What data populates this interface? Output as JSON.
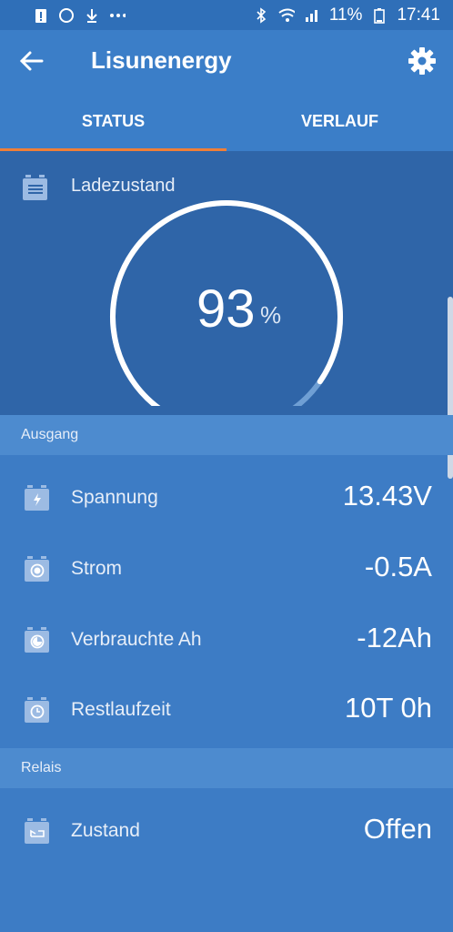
{
  "statusbar": {
    "battery_pct": "11%",
    "time": "17:41"
  },
  "appbar": {
    "title": "Lisunenergy"
  },
  "tabs": [
    {
      "label": "STATUS"
    },
    {
      "label": "VERLAUF"
    }
  ],
  "hero": {
    "label": "Ladezustand",
    "value": "93",
    "unit": "%",
    "gauge_fill": 0.93
  },
  "sections": {
    "output": "Ausgang",
    "relay": "Relais"
  },
  "rows": [
    {
      "label": "Spannung",
      "value": "13.43V",
      "icon": "bolt-icon"
    },
    {
      "label": "Strom",
      "value": "-0.5A",
      "icon": "current-icon"
    },
    {
      "label": "Verbrauchte Ah",
      "value": "-12Ah",
      "icon": "consumed-icon"
    },
    {
      "label": "Restlaufzeit",
      "value": "10T 0h",
      "icon": "clock-icon"
    }
  ],
  "relay_row": {
    "label": "Zustand",
    "value": "Offen",
    "icon": "relay-icon"
  },
  "colors": {
    "accent": "#f07f37",
    "background": "#3d7cc5",
    "header": "#3b7ec8"
  }
}
